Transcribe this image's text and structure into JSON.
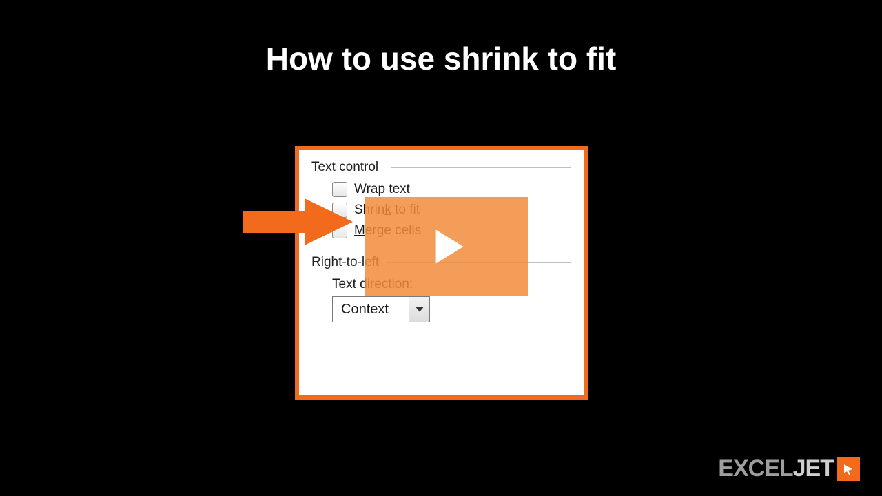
{
  "title": "How to use shrink to fit",
  "panel": {
    "text_control_legend": "Text control",
    "options": {
      "wrap": {
        "pre": "",
        "u": "W",
        "post": "rap text",
        "checked": false
      },
      "shrink": {
        "pre": "Shrin",
        "u": "k",
        "post": " to fit",
        "checked": false
      },
      "merge": {
        "pre": "",
        "u": "M",
        "post": "erge cells",
        "checked": false
      }
    },
    "rtl_legend": "Right-to-left",
    "direction_label": {
      "pre": "",
      "u": "T",
      "post": "ext direction:"
    },
    "direction_value": "Context"
  },
  "logo": {
    "part1": "EXCEL",
    "part2": "JET"
  }
}
